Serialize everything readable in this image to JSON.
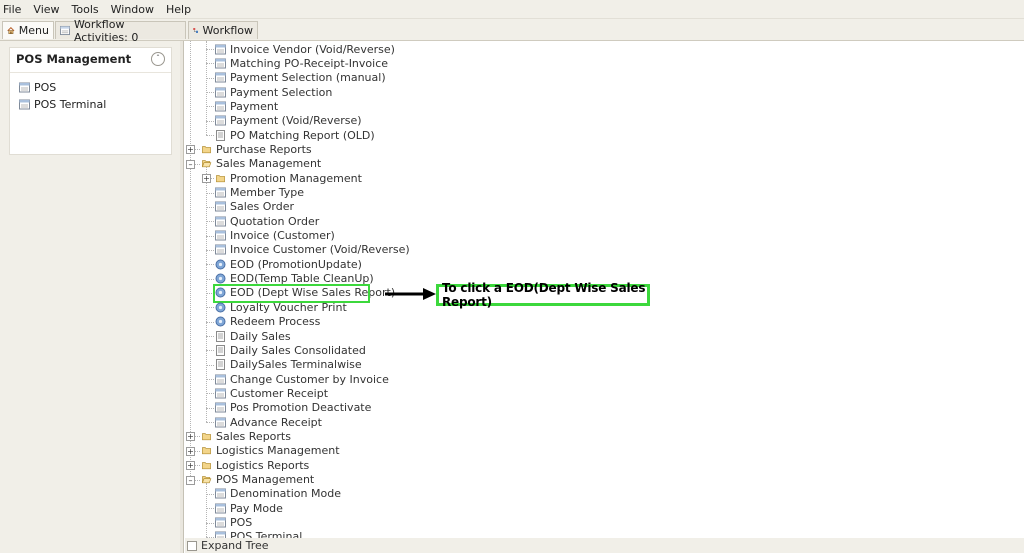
{
  "menubar": {
    "items": [
      "File",
      "View",
      "Tools",
      "Window",
      "Help"
    ]
  },
  "tabs": [
    {
      "label": "Menu",
      "icon": "home-icon"
    },
    {
      "label": "Workflow Activities: 0",
      "icon": "window-icon"
    },
    {
      "label": "Workflow",
      "icon": "workflow-icon"
    }
  ],
  "pos_panel": {
    "title": "POS Management",
    "items": [
      {
        "label": "POS",
        "icon": "window-icon"
      },
      {
        "label": "POS Terminal",
        "icon": "window-icon"
      }
    ]
  },
  "tree": {
    "rows": [
      {
        "label": "Invoice Vendor (Void/Reverse)",
        "icon": "window-icon",
        "level": 2
      },
      {
        "label": "Matching PO-Receipt-Invoice",
        "icon": "window-icon",
        "level": 2
      },
      {
        "label": "Payment Selection (manual)",
        "icon": "window-icon",
        "level": 2
      },
      {
        "label": "Payment Selection",
        "icon": "window-icon",
        "level": 2
      },
      {
        "label": "Payment",
        "icon": "window-icon",
        "level": 2
      },
      {
        "label": "Payment (Void/Reverse)",
        "icon": "window-icon",
        "level": 2
      },
      {
        "label": "PO Matching Report (OLD)",
        "icon": "report-icon",
        "level": 2
      },
      {
        "label": "Purchase Reports",
        "icon": "folder-icon",
        "level": 1,
        "toggle": "+"
      },
      {
        "label": "Sales Management",
        "icon": "folder-open-icon",
        "level": 1,
        "toggle": "-"
      },
      {
        "label": "Promotion Management",
        "icon": "folder-icon",
        "level": 2,
        "toggle": "+"
      },
      {
        "label": "Member Type",
        "icon": "window-icon",
        "level": 2
      },
      {
        "label": "Sales Order",
        "icon": "window-icon",
        "level": 2
      },
      {
        "label": "Quotation Order",
        "icon": "window-icon",
        "level": 2
      },
      {
        "label": "Invoice (Customer)",
        "icon": "window-icon",
        "level": 2
      },
      {
        "label": "Invoice Customer (Void/Reverse)",
        "icon": "window-icon",
        "level": 2
      },
      {
        "label": "EOD (PromotionUpdate)",
        "icon": "process-icon",
        "level": 2
      },
      {
        "label": "EOD(Temp Table CleanUp)",
        "icon": "process-icon",
        "level": 2
      },
      {
        "label": "EOD (Dept Wise Sales Report)",
        "icon": "process-icon",
        "level": 2,
        "highlighted": true
      },
      {
        "label": "Loyalty Voucher Print",
        "icon": "process-icon",
        "level": 2
      },
      {
        "label": "Redeem Process",
        "icon": "process-icon",
        "level": 2
      },
      {
        "label": "Daily Sales",
        "icon": "report-icon",
        "level": 2
      },
      {
        "label": "Daily Sales Consolidated",
        "icon": "report-icon",
        "level": 2
      },
      {
        "label": "DailySales Terminalwise",
        "icon": "report-icon",
        "level": 2
      },
      {
        "label": "Change Customer by Invoice",
        "icon": "window-icon",
        "level": 2
      },
      {
        "label": "Customer Receipt",
        "icon": "window-icon",
        "level": 2
      },
      {
        "label": "Pos Promotion Deactivate",
        "icon": "window-icon",
        "level": 2
      },
      {
        "label": "Advance Receipt",
        "icon": "window-icon",
        "level": 2
      },
      {
        "label": "Sales Reports",
        "icon": "folder-icon",
        "level": 1,
        "toggle": "+"
      },
      {
        "label": "Logistics Management",
        "icon": "folder-icon",
        "level": 1,
        "toggle": "+"
      },
      {
        "label": "Logistics Reports",
        "icon": "folder-icon",
        "level": 1,
        "toggle": "+"
      },
      {
        "label": "POS Management",
        "icon": "folder-open-icon",
        "level": 1,
        "toggle": "-"
      },
      {
        "label": "Denomination Mode",
        "icon": "window-icon",
        "level": 2
      },
      {
        "label": "Pay Mode",
        "icon": "window-icon",
        "level": 2
      },
      {
        "label": "POS",
        "icon": "window-icon",
        "level": 2
      },
      {
        "label": "POS Terminal",
        "icon": "window-icon",
        "level": 2
      }
    ]
  },
  "annotation": {
    "text": "To click a EOD(Dept Wise Sales Report)",
    "color": "#3cd83c"
  },
  "bottom": {
    "expand_tree_label": "Expand Tree"
  }
}
